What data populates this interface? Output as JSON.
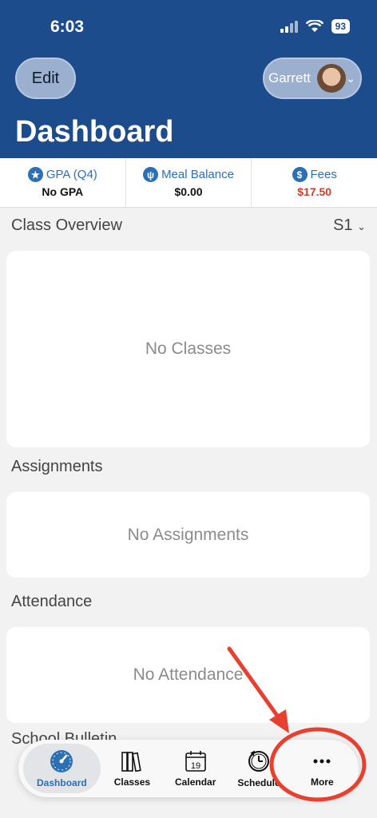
{
  "status": {
    "time": "6:03",
    "battery": "93"
  },
  "header": {
    "edit_label": "Edit",
    "profile_name": "Garrett",
    "title": "Dashboard"
  },
  "stats": [
    {
      "label": "GPA (Q4)",
      "value": "No GPA",
      "icon": "star-icon"
    },
    {
      "label": "Meal Balance",
      "value": "$0.00",
      "icon": "utensils-icon"
    },
    {
      "label": "Fees",
      "value": "$17.50",
      "icon": "dollar-icon",
      "value_color": "#d23a2a"
    }
  ],
  "sections": {
    "class_overview": {
      "title": "Class Overview",
      "semester": "S1",
      "empty": "No Classes"
    },
    "assignments": {
      "title": "Assignments",
      "empty": "No Assignments"
    },
    "attendance": {
      "title": "Attendance",
      "empty": "No Attendance"
    },
    "school_bulletin": {
      "title": "School Bulletin"
    }
  },
  "tabbar": [
    {
      "label": "Dashboard",
      "icon": "gauge-icon",
      "active": true
    },
    {
      "label": "Classes",
      "icon": "books-icon"
    },
    {
      "label": "Calendar",
      "icon": "calendar-icon",
      "date": "19"
    },
    {
      "label": "Schedule",
      "icon": "clock-icon"
    },
    {
      "label": "More",
      "icon": "ellipsis-icon"
    }
  ],
  "colors": {
    "header": "#1c4c8c",
    "accent": "#2c6fb3",
    "fees": "#d23a2a",
    "annotation": "#e8402f"
  }
}
